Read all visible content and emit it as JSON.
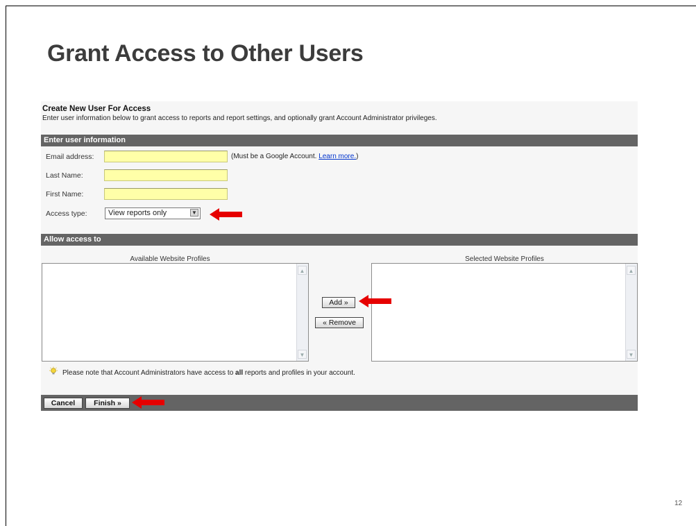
{
  "slide": {
    "title": "Grant Access to Other Users",
    "page_number": "12"
  },
  "form": {
    "heading": "Create New User For Access",
    "intro": "Enter user information below to grant access to reports and report settings, and optionally grant Account Administrator privileges.",
    "user_section_title": "Enter user information",
    "email_label": "Email address:",
    "email_value": "",
    "hint_prefix": "(Must be a Google Account. ",
    "hint_link": "Learn more.",
    "hint_suffix": ")",
    "last_name_label": "Last Name:",
    "last_name_value": "",
    "first_name_label": "First Name:",
    "first_name_value": "",
    "access_type_label": "Access type:",
    "access_type_selected": "View reports only",
    "access_section_title": "Allow access to",
    "available_caption": "Available Website Profiles",
    "selected_caption": "Selected Website Profiles",
    "add_button": "Add »",
    "remove_button": "« Remove",
    "note_prefix": "Please note that Account Administrators have access to ",
    "note_bold": "all",
    "note_suffix": " reports and profiles in your account.",
    "cancel_button": "Cancel",
    "finish_button": "Finish »"
  },
  "colors": {
    "section_bar": "#646464",
    "input_fill": "#ffffa8",
    "highlight_arrow": "#e60000",
    "link": "#0033cc"
  },
  "icons": {
    "tip": "lightbulb-icon",
    "pointer": "red-arrow-icon"
  }
}
